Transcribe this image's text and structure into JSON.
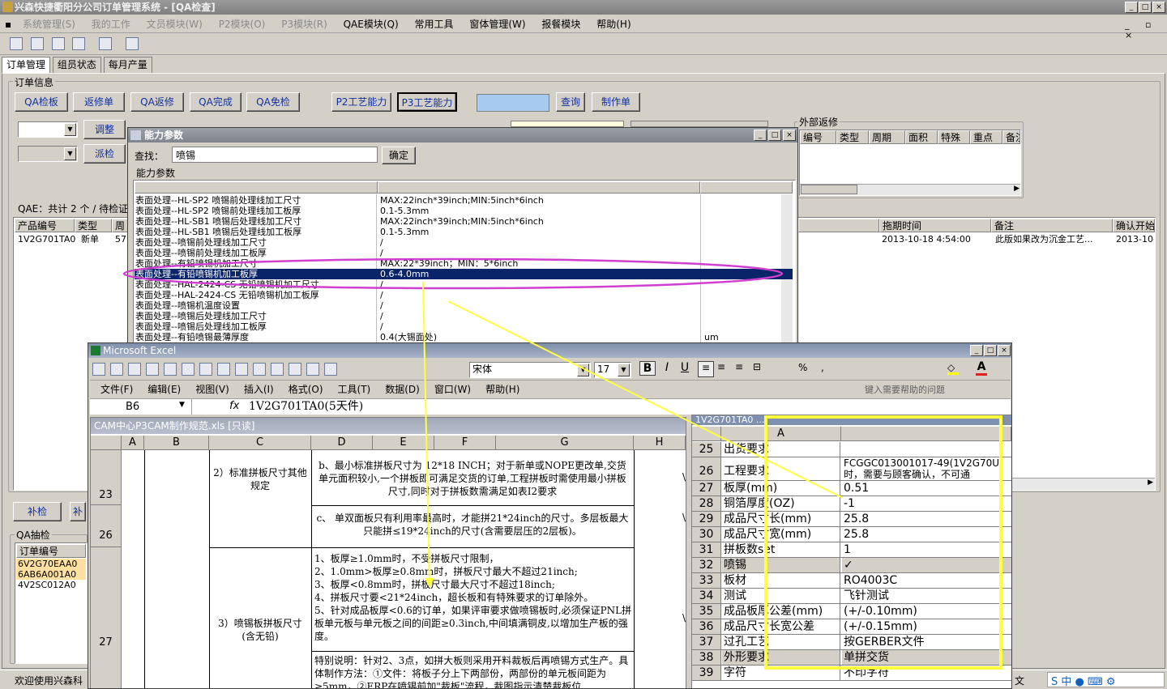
{
  "app": {
    "title": "兴森快捷衢阳分公司订单管理系统 - [QA检查]",
    "menu": [
      "系统管理(S)",
      "我的工作",
      "文员模块(W)",
      "P2模块(O)",
      "P3模块(R)",
      "QAE模块(Q)",
      "常用工具",
      "窗体管理(W)",
      "报餐模块",
      "帮助(H)"
    ],
    "tabs": [
      "订单管理",
      "组员状态",
      "每月产量"
    ],
    "order_info_label": "订单信息",
    "buttons": {
      "qa_check": "QA检板",
      "rework": "返修单",
      "qa_rework": "QA返修",
      "qa_done": "QA完成",
      "qa_exempt": "QA免检",
      "p2_cap": "P2工艺能力",
      "p3_cap": "P3工艺能力",
      "query": "查询",
      "make_order": "制作单",
      "adjust": "调整",
      "dispatch": "派检",
      "supplement": "补检",
      "second": "补"
    },
    "qae_status": "QAE：共计 2 个 / 待检证",
    "external_rework_label": "外部返修",
    "ext_columns": [
      "编号",
      "类型",
      "周期",
      "面积",
      "特殊",
      "重点",
      "备注"
    ],
    "main_columns_left": [
      "产品编号",
      "类型",
      "周"
    ],
    "main_columns_right": [
      "拖期时间",
      "备注",
      "确认开始"
    ],
    "main_row": {
      "pid": "1V2G701TA0",
      "type": "新单",
      "week": "57",
      "delay": "2013-10-18 4:54:00",
      "note": "此版如果改为沉金工艺...",
      "confirm": "2013-10-"
    },
    "qa_sample_label": "QA抽检",
    "qa_sample_col": "订单编号",
    "qa_sample_rows": [
      "6V2G70EAA0",
      "6AB6A001A0",
      "4V2SC012A0"
    ],
    "status_text": "欢迎使用兴森科",
    "status_right": "文"
  },
  "dialog": {
    "title": "能力参数",
    "search_label": "查找：",
    "search_value": "喷锡",
    "confirm": "确定",
    "group_label": "能力参数",
    "rows": [
      [
        "表面处理--HL-SP2 喷锡前处理线加工尺寸",
        "MAX:22inch*39inch;MIN:5inch*6inch",
        ""
      ],
      [
        "表面处理--HL-SP2 喷锡前处理线加工板厚",
        "0.1-5.3mm",
        ""
      ],
      [
        "表面处理--HL-SB1 喷锡后处理线加工尺寸",
        "MAX:22inch*39inch;MIN:5inch*6inch",
        ""
      ],
      [
        "表面处理--HL-SB1 喷锡后处理线加工板厚",
        "0.1-5.3mm",
        ""
      ],
      [
        "表面处理--喷锡前处理线加工尺寸",
        "/",
        ""
      ],
      [
        "表面处理--喷锡前处理线加工板厚",
        "/",
        ""
      ],
      [
        "表面处理--有铅喷锡机加工尺寸",
        "MAX:22*39inch；MIN：5*6inch",
        ""
      ],
      [
        "表面处理--有铅喷锡机加工板厚",
        "0.6-4.0mm",
        ""
      ],
      [
        "表面处理--HAL-2424-CS 无铅喷锡机加工尺寸",
        "/",
        ""
      ],
      [
        "表面处理--HAL-2424-CS 无铅喷锡机加工板厚",
        "/",
        ""
      ],
      [
        "表面处理--喷锡机温度设置",
        "/",
        ""
      ],
      [
        "表面处理--喷锡后处理线加工尺寸",
        "/",
        ""
      ],
      [
        "表面处理--喷锡后处理线加工板厚",
        "/",
        ""
      ],
      [
        "表面处理--有铅喷锡最薄厚度",
        "0.4(大锡面处)",
        "um"
      ]
    ],
    "selected_index": 7
  },
  "excel": {
    "title": "Microsoft Excel",
    "menu": [
      "文件(F)",
      "编辑(E)",
      "视图(V)",
      "插入(I)",
      "格式(O)",
      "工具(T)",
      "数据(D)",
      "窗口(W)",
      "帮助(H)"
    ],
    "help_placeholder": "键入需要帮助的问题",
    "font_name": "宋体",
    "font_size": "17",
    "cell_ref": "B6",
    "formula": "1V2G701TA0(5天件)",
    "workbook_title": "CAM中心P3CAM制作规范.xls [只读]",
    "columns": [
      "A",
      "B",
      "C",
      "D",
      "E",
      "F",
      "G",
      "H"
    ],
    "row_numbers": [
      "23",
      "26",
      "27"
    ],
    "c_23": "2）标准拼板尺寸其他规定",
    "d_23": "b、最小标准拼板尺寸为 12*18 INCH；对于新单或NOPE更改单,交货单元面积较小,一个拼板即可满足交货的订单,工程拼板时需使用最小拼板尺寸,同时对于拼板数需满足如表I2要求",
    "d_23b": "c、 单双面板只有利用率最高时，才能拼21*24inch的尺寸。多层板最大只能拼≤19*24inch的尺寸(含需要层压的2层板)。",
    "c_27": "3）喷锡板拼板尺寸(含无铅)",
    "d_27": "1、板厚≥1.0mm时，不受拼板尺寸限制，\n2、1.0mm>板厚≥0.8mm时，拼板尺寸最大不超过21inch;\n3、板厚<0.8mm时，拼板尺寸最大尺寸不超过18inch;\n4、拼板尺寸要<21*24inch，超长板和有特殊要求的订单除外。\n5、针对成品板厚<0.6的订单，如果评审要求做喷锡板时,必须保证PNL拼板单元板与单元板之间的间距≥0.3inch,中间填满铜皮,以增加生产板的强度。",
    "d_27b": "特别说明：针对2、3点，如拼大板则采用开料裁板后再喷锡方式生产。具体制作方法：①文件：将板子分上下两部份，两部份的单元板间距为≥5mm，②ERP在喷锡前加\"裁板\"流程，裁图指示清楚裁板位",
    "slash": "\\",
    "right_sheet_title": "1V2G701TA0 ... ",
    "right_col": "A",
    "right_rows": [
      {
        "n": "25",
        "a": "出货要求",
        "b": ""
      },
      {
        "n": "26",
        "a": "工程要求",
        "b": "FCGGC013001017-49(1V2G70U时，需要与顾客确认，不可通"
      },
      {
        "n": "27",
        "a": "板厚(mm)",
        "b": "0.51"
      },
      {
        "n": "28",
        "a": "铜箔厚度(OZ)",
        "b": "-1"
      },
      {
        "n": "29",
        "a": "成品尺寸长(mm)",
        "b": "25.8"
      },
      {
        "n": "30",
        "a": "成品尺寸宽(mm)",
        "b": "25.8"
      },
      {
        "n": "31",
        "a": "拼板数set",
        "b": "1"
      },
      {
        "n": "32",
        "a": "喷锡",
        "b": "✓"
      },
      {
        "n": "33",
        "a": "板材",
        "b": "RO4003C"
      },
      {
        "n": "34",
        "a": "测试",
        "b": "飞针测试"
      },
      {
        "n": "35",
        "a": "成品板厚公差(mm)",
        "b": "(+/-0.10mm)"
      },
      {
        "n": "36",
        "a": "成品尺寸长宽公差",
        "b": "(+/-0.15mm)"
      },
      {
        "n": "37",
        "a": "过孔工艺",
        "b": "按GERBER文件"
      },
      {
        "n": "38",
        "a": "外形要求",
        "b": "单拼交货"
      },
      {
        "n": "39",
        "a": "字符",
        "b": "不印字符"
      }
    ]
  },
  "colors": {
    "highlight_ellipse": "#d040d0",
    "arrow": "#ffff40",
    "selection": "#0a246a"
  }
}
